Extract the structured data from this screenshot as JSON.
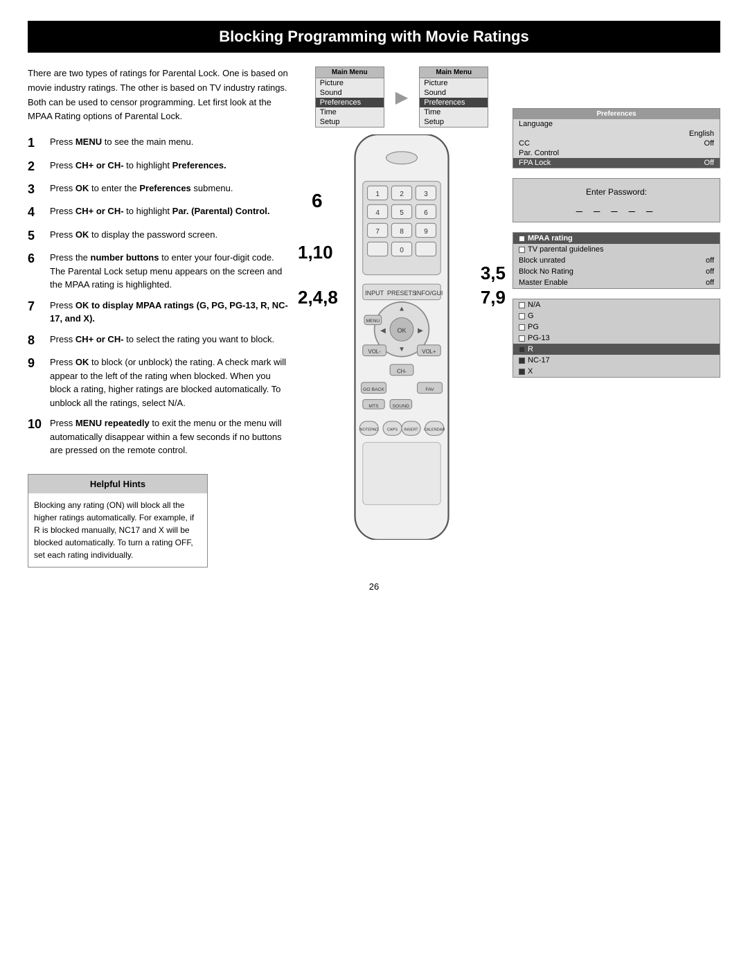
{
  "page": {
    "title": "Blocking Programming with Movie Ratings",
    "page_number": "26"
  },
  "intro": {
    "text": "There are two types of ratings for Parental Lock. One is based on movie industry ratings. The other is based on TV industry ratings. Both can be used to censor programming. Let first look at the MPAA Rating options of Parental Lock."
  },
  "steps": [
    {
      "number": "1",
      "text": "Press <b>MENU</b> to see the main menu."
    },
    {
      "number": "2",
      "text": "Press <b>CH+ or CH-</b> to highlight <b>Preferences.</b>"
    },
    {
      "number": "3",
      "text": "Press <b>OK</b> to enter the <b>Preferences</b> submenu."
    },
    {
      "number": "4",
      "text": "Press <b>CH+ or CH-</b> to highlight <b>Par. (Parental) Control.</b>"
    },
    {
      "number": "5",
      "text": "Press <b>OK</b> to display the password screen."
    },
    {
      "number": "6",
      "text": "Press the <b>number buttons</b> to enter your four-digit code. The Parental Lock setup menu appears on the screen and the MPAA rating is highlighted."
    },
    {
      "number": "7",
      "text": "Press <b>OK to display MPAA ratings (G, PG, PG-13, R, NC-17, and X).</b>"
    },
    {
      "number": "8",
      "text": "Press <b>CH+ or CH-</b> to select the rating you want to block."
    },
    {
      "number": "9",
      "text": "Press <b>OK</b> to block (or unblock) the rating. A check mark will appear to the left of the rating when blocked. When you block a rating, higher ratings are blocked automatically. To unblock all the ratings, select N/A."
    },
    {
      "number": "10",
      "text": "Press <b>MENU repeatedly</b> to exit the menu or the menu will automatically disappear within a few seconds if no buttons are pressed on the remote control."
    }
  ],
  "helpful_hints": {
    "title": "Helpful Hints",
    "text": "Blocking any rating (ON) will block all the higher ratings automatically. For example, if R is blocked manually, NC17 and X will be blocked automatically. To turn a rating OFF, set each rating individually."
  },
  "remote_labels": {
    "label_6": "6",
    "label_110": "1,10",
    "label_248": "2,4,8",
    "label_359": "3,5",
    "label_79": "7,9"
  },
  "menu_box_1": {
    "title": "Main Menu",
    "items": [
      "Picture",
      "Sound",
      "Preferences",
      "Time",
      "Setup"
    ]
  },
  "menu_box_2": {
    "title": "Main Menu",
    "items": [
      "Picture",
      "Sound",
      "Preferences",
      "Time",
      "Setup"
    ]
  },
  "preferences_screen": {
    "title": "Preferences",
    "items": [
      {
        "label": "Language",
        "value": "",
        "highlighted": false
      },
      {
        "label": "",
        "value": "English",
        "highlighted": false
      },
      {
        "label": "CC",
        "value": "Off",
        "highlighted": false
      },
      {
        "label": "Par. Control",
        "value": "",
        "highlighted": false
      },
      {
        "label": "FPA Lock",
        "value": "Off",
        "highlighted": true
      }
    ]
  },
  "password_screen": {
    "label": "Enter Password:",
    "dashes": "_ _ _ _ _"
  },
  "mpaa_screen": {
    "items": [
      {
        "label": "MPAA rating",
        "checked": false,
        "highlighted": true
      },
      {
        "label": "TV parental guidelines",
        "checked": false,
        "highlighted": false
      },
      {
        "label": "Block unrated",
        "value": "off",
        "checked": false
      },
      {
        "label": "Block No Rating",
        "value": "off",
        "checked": false
      },
      {
        "label": "Master Enable",
        "value": "off",
        "checked": false
      }
    ]
  },
  "ratings_screen": {
    "items": [
      {
        "label": "N/A",
        "checked": false
      },
      {
        "label": "G",
        "checked": false
      },
      {
        "label": "PG",
        "checked": false
      },
      {
        "label": "PG-13",
        "checked": false
      },
      {
        "label": "R",
        "checked": true,
        "highlighted": true
      },
      {
        "label": "NC-17",
        "checked": true
      },
      {
        "label": "X",
        "checked": true
      }
    ]
  }
}
